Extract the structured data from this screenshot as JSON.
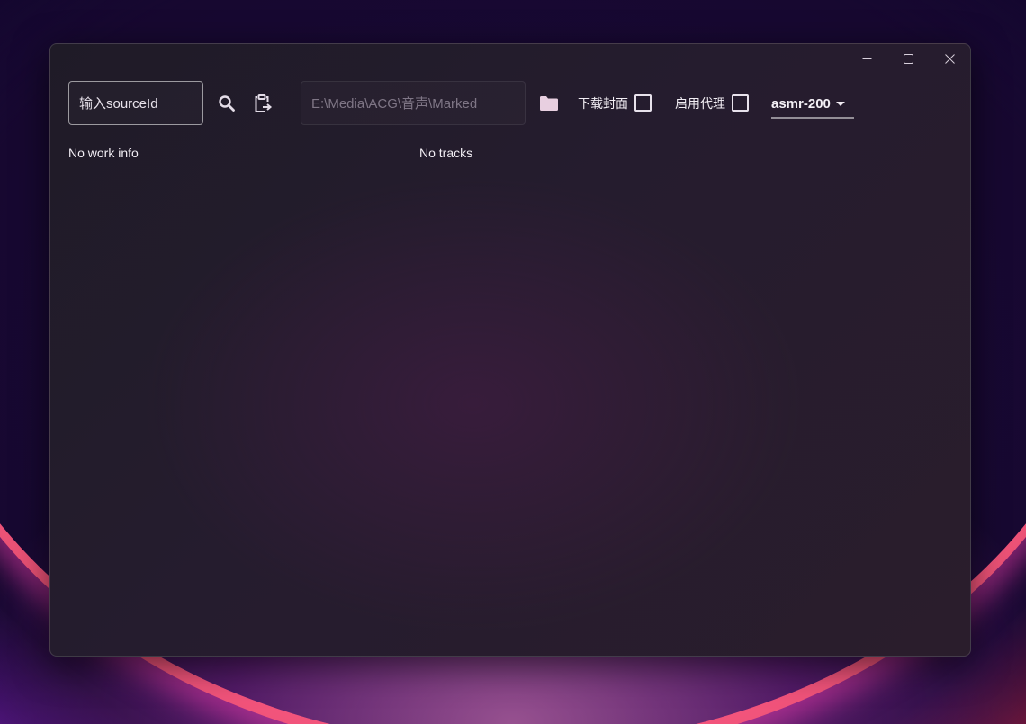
{
  "window": {
    "controls": {
      "minimize_icon": "minimize-icon",
      "maximize_icon": "maximize-icon",
      "close_icon": "close-icon"
    }
  },
  "toolbar": {
    "source_input": {
      "placeholder": "输入sourceId",
      "value": ""
    },
    "search_icon": "search-icon",
    "paste_icon": "clipboard-paste-icon",
    "path_input": {
      "placeholder": "E:\\Media\\ACG\\音声\\Marked",
      "value": ""
    },
    "folder_icon": "folder-icon",
    "download_cover": {
      "label": "下载封面",
      "checked": false
    },
    "enable_proxy": {
      "label": "启用代理",
      "checked": false
    },
    "source_select": {
      "selected": "asmr-200"
    }
  },
  "main": {
    "work_info_text": "No work info",
    "tracks_text": "No tracks"
  },
  "colors": {
    "window_bg": "#221c2b",
    "text": "#f2eef4",
    "muted_text": "#7f7686",
    "folder_accent": "#e8cfe0"
  }
}
